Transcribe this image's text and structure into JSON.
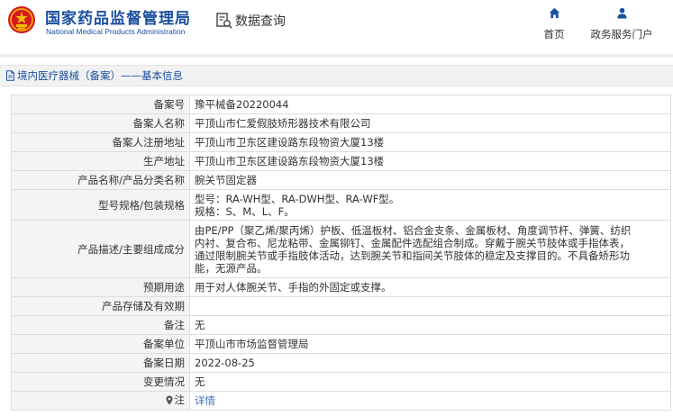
{
  "header": {
    "logo_cn": "国家药品监督管理局",
    "logo_en": "National Medical Products Administration",
    "data_query": "数据查询",
    "nav": {
      "home": "首页",
      "gov_portal": "政务服务门户"
    }
  },
  "breadcrumb": "境内医疗器械（备案）——基本信息",
  "rows": [
    {
      "label": "备案号",
      "value": "豫平械备20220044"
    },
    {
      "label": "备案人名称",
      "value": "平顶山市仁爱假肢矫形器技术有限公司"
    },
    {
      "label": "备案人注册地址",
      "value": "平顶山市卫东区建设路东段物资大厦13楼"
    },
    {
      "label": "生产地址",
      "value": "平顶山市卫东区建设路东段物资大厦13楼"
    },
    {
      "label": "产品名称/产品分类名称",
      "value": "腕关节固定器"
    },
    {
      "label": "型号规格/包装规格",
      "lines": [
        "型号：RA-WH型、RA-DWH型、RA-WF型。",
        "规格：S、M、L、F。"
      ]
    },
    {
      "label": "产品描述/主要组成成分",
      "lines": [
        "由PE/PP（聚乙烯/聚丙烯）护板、低温板材、铝合金支条、金属板材、角度调节杆、弹簧、纺织",
        "内衬、复合布、尼龙粘带、金属铆钉、金属配件选配组合制成。穿戴于腕关节肢体或手指体表，",
        "通过限制腕关节或手指肢体活动，达到腕关节和指间关节肢体的稳定及支撑目的。不具备矫形功",
        "能，无源产品。"
      ]
    },
    {
      "label": "预期用途",
      "value": "用于对人体腕关节、手指的外固定或支撑。"
    },
    {
      "label": "产品存储及有效期",
      "value": ""
    },
    {
      "label": "备注",
      "value": "无"
    },
    {
      "label": "备案单位",
      "value": "平顶山市市场监督管理局"
    },
    {
      "label": "备案日期",
      "value": "2022-08-25"
    },
    {
      "label": "变更情况",
      "value": "无"
    },
    {
      "label": "注",
      "value": "详情"
    }
  ],
  "colors": {
    "brand_blue": "#1a4fa0",
    "emblem_red": "#d71920",
    "link_blue": "#3a6fc0"
  },
  "icons": {
    "home": "home-icon",
    "user": "user-icon",
    "search_doc": "search-document-icon",
    "doc": "document-icon",
    "location": "location-pin-icon"
  }
}
